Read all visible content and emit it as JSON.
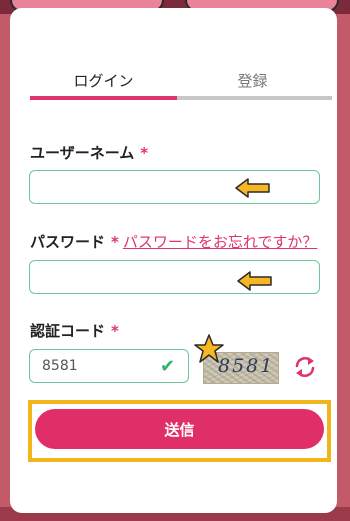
{
  "tabs": [
    {
      "label": "ログイン",
      "active": true
    },
    {
      "label": "登録",
      "active": false
    }
  ],
  "form": {
    "username_label": "ユーザーネーム",
    "password_label": "パスワード",
    "forgot_link": "パスワードをお忘れですか？",
    "captcha_label": "認証コード",
    "required_mark": "*",
    "username_value": "",
    "password_value": "",
    "captcha_value": "8581",
    "captcha_image_text": "8581",
    "submit_label": "送信"
  },
  "colors": {
    "accent": "#e0356c",
    "valid": "#2fb36a",
    "highlight": "#f2b51c"
  },
  "icons": {
    "check": "check-icon",
    "refresh": "refresh-icon",
    "arrow": "arrow-left-icon",
    "star": "star-icon"
  }
}
